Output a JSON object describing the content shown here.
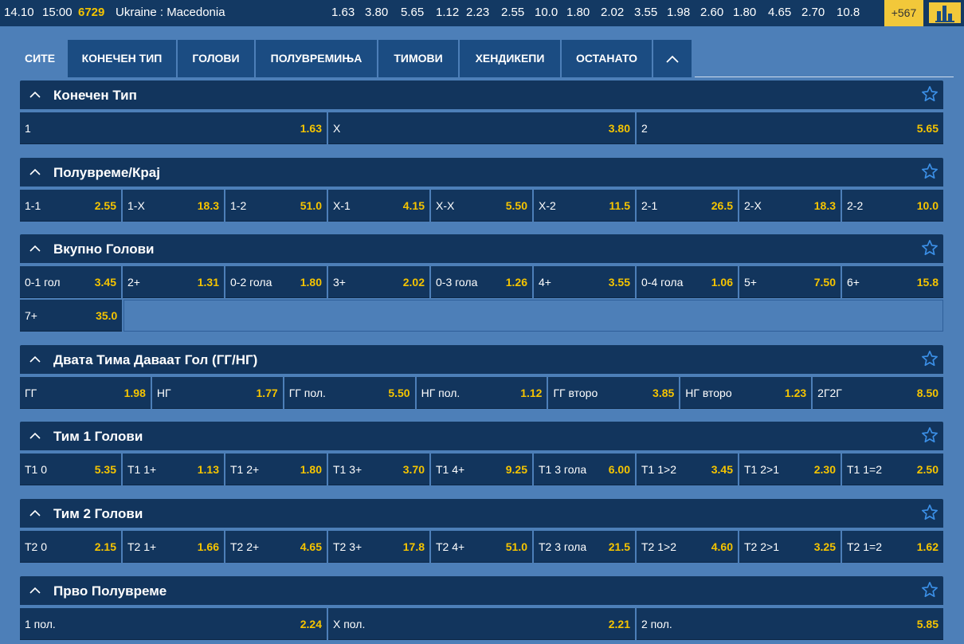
{
  "topbar": {
    "date": "14.10",
    "time": "15:00",
    "code": "6729",
    "match": "Ukraine : Macedonia",
    "odds": [
      "1.63",
      "3.80",
      "5.65",
      "1.12",
      "2.23",
      "2.55",
      "10.0",
      "1.80",
      "2.02",
      "3.55",
      "1.98",
      "2.60",
      "1.80",
      "4.65",
      "2.70",
      "10.8"
    ],
    "more": "+567",
    "stats_icon": "bar-chart-icon"
  },
  "tabs": [
    {
      "label": "СИТЕ"
    },
    {
      "label": "КОНЕЧЕН ТИП"
    },
    {
      "label": "ГОЛОВИ"
    },
    {
      "label": "ПОЛУВРЕМИЊА"
    },
    {
      "label": "ТИМОВИ"
    },
    {
      "label": "ХЕНДИКЕПИ"
    },
    {
      "label": "ОСТАНАТО"
    }
  ],
  "colors": {
    "background": "#4d7fb8",
    "panel": "#12355d",
    "odds": "#f5c400",
    "accent": "#f2c83a"
  },
  "sections": [
    {
      "title": "Конечен Тип",
      "rows": [
        [
          [
            "1",
            "1.63"
          ],
          [
            "X",
            "3.80"
          ],
          [
            "2",
            "5.65"
          ]
        ]
      ]
    },
    {
      "title": "Полувреме/Крај",
      "rows": [
        [
          [
            "1-1",
            "2.55"
          ],
          [
            "1-X",
            "18.3"
          ],
          [
            "1-2",
            "51.0"
          ],
          [
            "X-1",
            "4.15"
          ],
          [
            "X-X",
            "5.50"
          ],
          [
            "X-2",
            "11.5"
          ],
          [
            "2-1",
            "26.5"
          ],
          [
            "2-X",
            "18.3"
          ],
          [
            "2-2",
            "10.0"
          ]
        ]
      ]
    },
    {
      "title": "Вкупно Голови",
      "rows": [
        [
          [
            "0-1 гол",
            "3.45"
          ],
          [
            "2+",
            "1.31"
          ],
          [
            "0-2 гола",
            "1.80"
          ],
          [
            "3+",
            "2.02"
          ],
          [
            "0-3 гола",
            "1.26"
          ],
          [
            "4+",
            "3.55"
          ],
          [
            "0-4 гола",
            "1.06"
          ],
          [
            "5+",
            "7.50"
          ],
          [
            "6+",
            "15.8"
          ]
        ],
        [
          [
            "7+",
            "35.0"
          ]
        ]
      ]
    },
    {
      "title": "Двата Тима Даваат Гол (ГГ/НГ)",
      "rows": [
        [
          [
            "ГГ",
            "1.98"
          ],
          [
            "НГ",
            "1.77"
          ],
          [
            "ГГ пол.",
            "5.50"
          ],
          [
            "НГ пол.",
            "1.12"
          ],
          [
            "ГГ второ",
            "3.85"
          ],
          [
            "НГ второ",
            "1.23"
          ],
          [
            "2Г2Г",
            "8.50"
          ]
        ]
      ]
    },
    {
      "title": "Тим 1 Голови",
      "rows": [
        [
          [
            "Т1 0",
            "5.35"
          ],
          [
            "Т1 1+",
            "1.13"
          ],
          [
            "Т1 2+",
            "1.80"
          ],
          [
            "Т1 3+",
            "3.70"
          ],
          [
            "Т1 4+",
            "9.25"
          ],
          [
            "Т1 3 гола",
            "6.00"
          ],
          [
            "Т1 1>2",
            "3.45"
          ],
          [
            "Т1 2>1",
            "2.30"
          ],
          [
            "Т1 1=2",
            "2.50"
          ]
        ]
      ]
    },
    {
      "title": "Тим 2 Голови",
      "rows": [
        [
          [
            "Т2 0",
            "2.15"
          ],
          [
            "Т2 1+",
            "1.66"
          ],
          [
            "Т2 2+",
            "4.65"
          ],
          [
            "Т2 3+",
            "17.8"
          ],
          [
            "Т2 4+",
            "51.0"
          ],
          [
            "Т2 3 гола",
            "21.5"
          ],
          [
            "Т2 1>2",
            "4.60"
          ],
          [
            "Т2 2>1",
            "3.25"
          ],
          [
            "Т2 1=2",
            "1.62"
          ]
        ]
      ]
    },
    {
      "title": "Прво Полувреме",
      "rows": [
        [
          [
            "1 пол.",
            "2.24"
          ],
          [
            "X пол.",
            "2.21"
          ],
          [
            "2 пол.",
            "5.85"
          ]
        ]
      ]
    }
  ]
}
